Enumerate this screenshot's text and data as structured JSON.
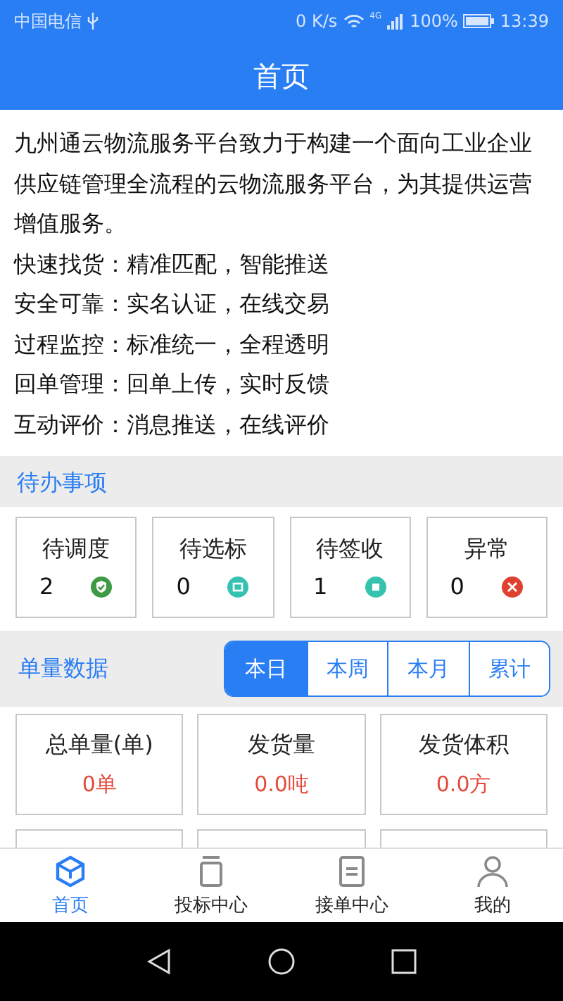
{
  "status_bar": {
    "carrier": "中国电信",
    "speed": "0 K/s",
    "network": "4G",
    "battery": "100%",
    "time": "13:39"
  },
  "header": {
    "title": "首页"
  },
  "intro": {
    "paragraph": "九州通云物流服务平台致力于构建一个面向工业企业供应链管理全流程的云物流服务平台，为其提供运营增值服务。",
    "features": [
      "快速找货：精准匹配，智能推送",
      "安全可靠：实名认证，在线交易",
      "过程监控：标准统一，全程透明",
      "回单管理：回单上传，实时反馈",
      "互动评价：消息推送，在线评价"
    ]
  },
  "todo": {
    "title": "待办事项",
    "items": [
      {
        "label": "待调度",
        "count": "2",
        "kind": "check",
        "color": "#3f9a45"
      },
      {
        "label": "待选标",
        "count": "0",
        "kind": "tag",
        "color": "#35c3b0"
      },
      {
        "label": "待签收",
        "count": "1",
        "kind": "square",
        "color": "#35c3b0"
      },
      {
        "label": "异常",
        "count": "0",
        "kind": "cross",
        "color": "#e0412f"
      }
    ]
  },
  "stats": {
    "title": "单量数据",
    "periods": [
      {
        "label": "本日",
        "selected": true
      },
      {
        "label": "本周",
        "selected": false
      },
      {
        "label": "本月",
        "selected": false
      },
      {
        "label": "累计",
        "selected": false
      }
    ],
    "cards": [
      {
        "label": "总单量(单)",
        "value": "0单"
      },
      {
        "label": "发货量",
        "value": "0.0吨"
      },
      {
        "label": "发货体积",
        "value": "0.0方"
      }
    ]
  },
  "bottom_nav": [
    {
      "label": "首页",
      "kind": "cube",
      "selected": true
    },
    {
      "label": "投标中心",
      "kind": "stack",
      "selected": false
    },
    {
      "label": "接单中心",
      "kind": "doc",
      "selected": false
    },
    {
      "label": "我的",
      "kind": "person",
      "selected": false
    }
  ]
}
